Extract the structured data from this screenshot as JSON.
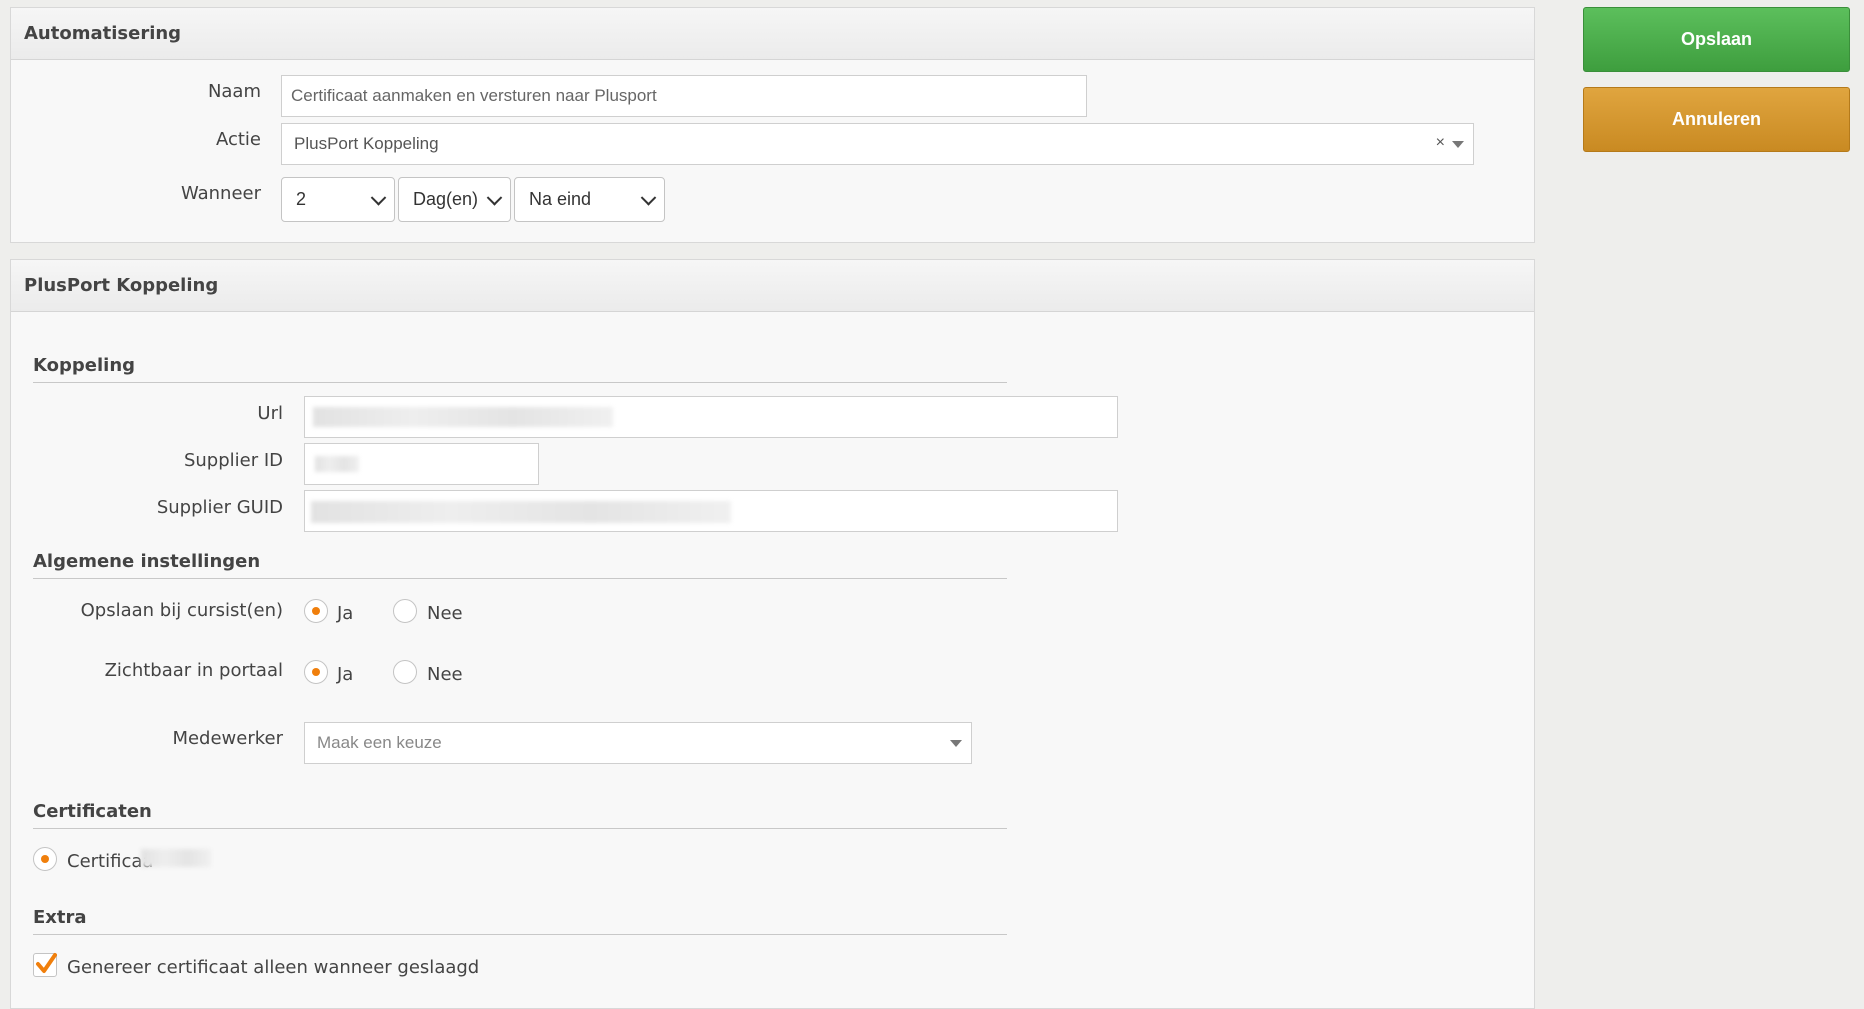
{
  "automation": {
    "title": "Automatisering",
    "name_label": "Naam",
    "name_value": "Certificaat aanmaken en versturen naar Plusport",
    "action_label": "Actie",
    "action_value": "PlusPort Koppeling",
    "action_clear": "×",
    "when_label": "Wanneer",
    "when_amount": "2",
    "when_unit": "Dag(en)",
    "when_moment": "Na eind"
  },
  "plusport": {
    "title": "PlusPort Koppeling",
    "koppeling": {
      "title": "Koppeling",
      "url_label": "Url",
      "supplier_id_label": "Supplier ID",
      "supplier_guid_label": "Supplier GUID"
    },
    "general": {
      "title": "Algemene instellingen",
      "save_label": "Opslaan bij cursist(en)",
      "visible_label": "Zichtbaar in portaal",
      "yes": "Ja",
      "no": "Nee",
      "save_selected": "Ja",
      "visible_selected": "Ja",
      "employee_label": "Medewerker",
      "employee_placeholder": "Maak een keuze"
    },
    "certificates": {
      "title": "Certificaten",
      "item_label": "Certificaa"
    },
    "extra": {
      "title": "Extra",
      "only_passed_label": "Genereer certificaat alleen wanneer geslaagd",
      "only_passed_checked": true
    }
  },
  "actions": {
    "save": "Opslaan",
    "cancel": "Annuleren"
  },
  "colors": {
    "accent": "#f07f0c",
    "save_button": "#4caf50",
    "cancel_button": "#d4972e"
  }
}
